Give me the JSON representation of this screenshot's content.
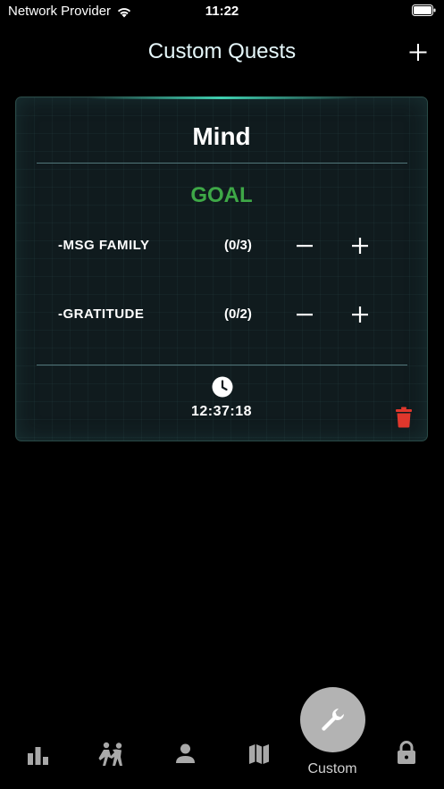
{
  "status_bar": {
    "carrier": "Network Provider",
    "time": "11:22"
  },
  "nav": {
    "title": "Custom Quests"
  },
  "card": {
    "title": "Mind",
    "goal_label": "GOAL",
    "tasks": [
      {
        "name": "-MSG FAMILY",
        "progress": "(0/3)",
        "done": 0,
        "target": 3
      },
      {
        "name": "-GRATITUDE",
        "progress": "(0/2)",
        "done": 0,
        "target": 2
      }
    ],
    "timer": "12:37:18"
  },
  "tab_bar": {
    "items": [
      {
        "icon": "bar-chart-icon"
      },
      {
        "icon": "sparring-icon"
      },
      {
        "icon": "person-icon"
      },
      {
        "icon": "map-icon"
      },
      {
        "icon": "wrench-icon",
        "label": "Custom",
        "selected": true
      },
      {
        "icon": "lock-icon"
      }
    ]
  },
  "colors": {
    "background": "#000000",
    "goal_green": "#3ea847",
    "delete_red": "#e0372c",
    "card_background": "#101b1e",
    "tab_icon": "#a9a9a9",
    "selected_circle": "#b3b3b3"
  }
}
